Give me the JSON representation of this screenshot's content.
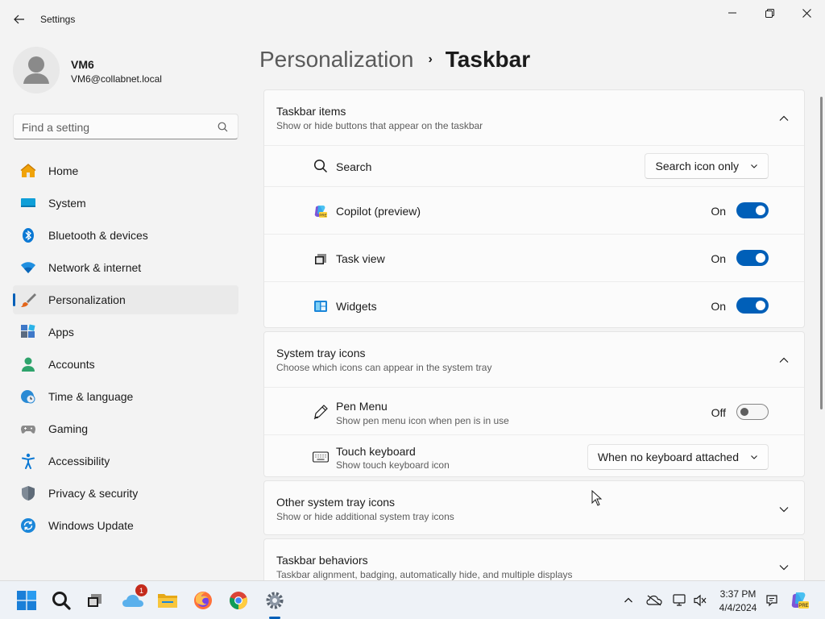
{
  "window": {
    "title": "Settings"
  },
  "user": {
    "name": "VM6",
    "email": "VM6@collabnet.local"
  },
  "search": {
    "placeholder": "Find a setting"
  },
  "sidebar": {
    "items": [
      {
        "label": "Home",
        "icon": "home-icon"
      },
      {
        "label": "System",
        "icon": "system-icon"
      },
      {
        "label": "Bluetooth & devices",
        "icon": "bluetooth-icon"
      },
      {
        "label": "Network & internet",
        "icon": "wifi-icon"
      },
      {
        "label": "Personalization",
        "icon": "brush-icon",
        "selected": true
      },
      {
        "label": "Apps",
        "icon": "apps-icon"
      },
      {
        "label": "Accounts",
        "icon": "accounts-icon"
      },
      {
        "label": "Time & language",
        "icon": "clock-globe-icon"
      },
      {
        "label": "Gaming",
        "icon": "gamepad-icon"
      },
      {
        "label": "Accessibility",
        "icon": "accessibility-icon"
      },
      {
        "label": "Privacy & security",
        "icon": "shield-icon"
      },
      {
        "label": "Windows Update",
        "icon": "update-icon"
      }
    ]
  },
  "breadcrumb": {
    "parent": "Personalization",
    "separator": "›",
    "current": "Taskbar"
  },
  "sections": {
    "taskbar_items": {
      "title": "Taskbar items",
      "subtitle": "Show or hide buttons that appear on the taskbar",
      "expanded": true,
      "rows": {
        "search": {
          "label": "Search",
          "value": "Search icon only"
        },
        "copilot": {
          "label": "Copilot (preview)",
          "state": "On"
        },
        "task_view": {
          "label": "Task view",
          "state": "On"
        },
        "widgets": {
          "label": "Widgets",
          "state": "On"
        }
      }
    },
    "system_tray_icons": {
      "title": "System tray icons",
      "subtitle": "Choose which icons can appear in the system tray",
      "expanded": true,
      "rows": {
        "pen_menu": {
          "label": "Pen Menu",
          "description": "Show pen menu icon when pen is in use",
          "state": "Off"
        },
        "touch_keyboard": {
          "label": "Touch keyboard",
          "description": "Show touch keyboard icon",
          "value": "When no keyboard attached"
        }
      }
    },
    "other_tray_icons": {
      "title": "Other system tray icons",
      "subtitle": "Show or hide additional system tray icons",
      "expanded": false
    },
    "taskbar_behaviors": {
      "title": "Taskbar behaviors",
      "subtitle": "Taskbar alignment, badging, automatically hide, and multiple displays",
      "expanded": false
    }
  },
  "taskbar": {
    "icons": [
      "start-icon",
      "search-icon",
      "task-view-icon",
      "weather-icon",
      "file-explorer-icon",
      "firefox-icon",
      "chrome-icon",
      "settings-icon"
    ],
    "weather_badge": "1",
    "time": "3:37 PM",
    "date": "4/4/2024",
    "tray_icons": [
      "chevron-up-icon",
      "onedrive-icon",
      "network-icon",
      "volume-icon",
      "notification-icon",
      "copilot-icon"
    ]
  },
  "colors": {
    "accent": "#005fb8",
    "background": "#f3f3f3",
    "card": "#fbfbfb"
  }
}
